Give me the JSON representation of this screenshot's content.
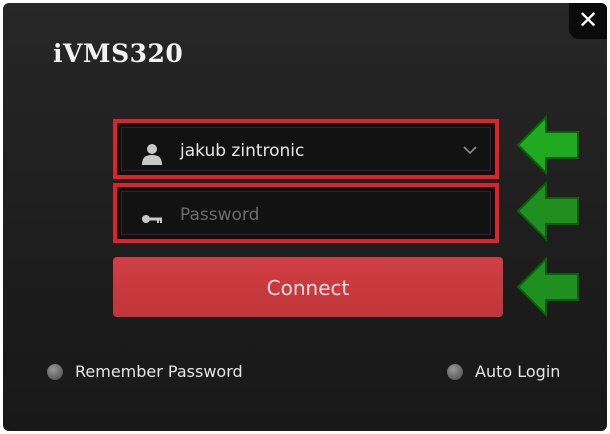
{
  "window": {
    "app_title": "iVMS320",
    "close_symbol": "✕"
  },
  "login": {
    "username_value": "jakub zintronic",
    "password_placeholder": "Password",
    "connect_label": "Connect"
  },
  "options": {
    "remember_password_label": "Remember Password",
    "auto_login_label": "Auto Login"
  },
  "colors": {
    "highlight_red": "#e0202a",
    "connect_button": "#c83a3e",
    "arrow_green": "#1faa1f",
    "window_bg": "#1f1f1f"
  },
  "icons": [
    "user-icon",
    "key-icon",
    "chevron-down-icon",
    "close-icon",
    "green-arrow-icon"
  ]
}
